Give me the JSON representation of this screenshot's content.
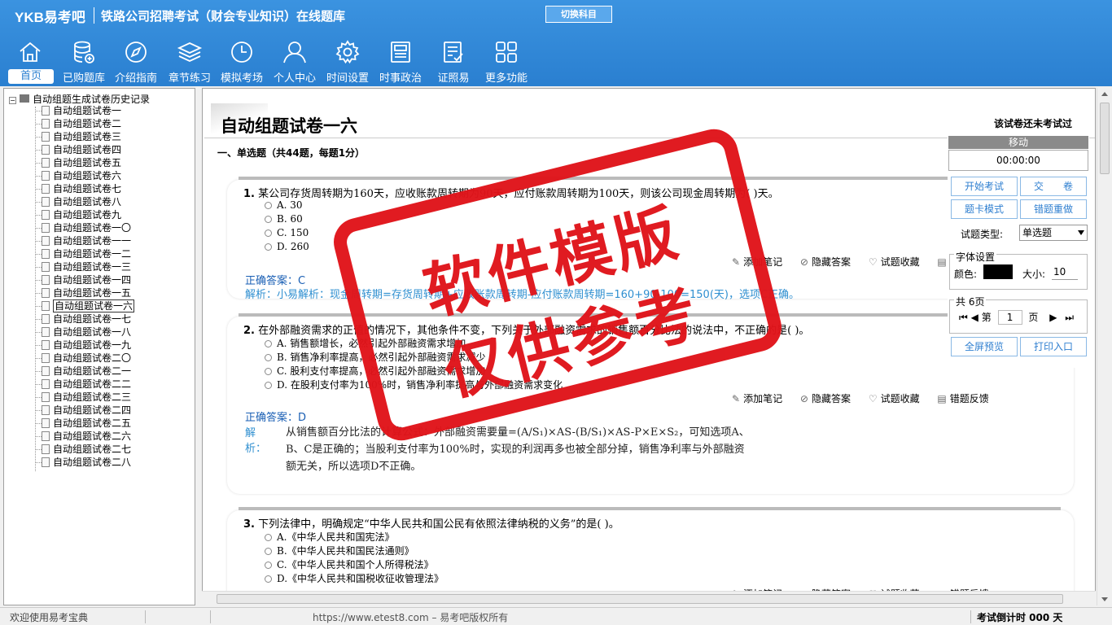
{
  "header": {
    "logo": "YKB易考吧",
    "title": "铁路公司招聘考试（财会专业知识）在线题库",
    "switch_label": "切换科目"
  },
  "nav": [
    {
      "label": "首页",
      "icon": "home-icon"
    },
    {
      "label": "已购题库",
      "icon": "database-icon"
    },
    {
      "label": "介绍指南",
      "icon": "compass-icon"
    },
    {
      "label": "章节练习",
      "icon": "layers-icon"
    },
    {
      "label": "模拟考场",
      "icon": "clock-icon"
    },
    {
      "label": "个人中心",
      "icon": "user-icon"
    },
    {
      "label": "时间设置",
      "icon": "gear-icon"
    },
    {
      "label": "时事政治",
      "icon": "news-icon"
    },
    {
      "label": "证照易",
      "icon": "checklist-icon"
    },
    {
      "label": "更多功能",
      "icon": "grid-icon"
    }
  ],
  "tree": {
    "root": "自动组题生成试卷历史记录",
    "items": [
      "自动组题试卷一",
      "自动组题试卷二",
      "自动组题试卷三",
      "自动组题试卷四",
      "自动组题试卷五",
      "自动组题试卷六",
      "自动组题试卷七",
      "自动组题试卷八",
      "自动组题试卷九",
      "自动组题试卷一〇",
      "自动组题试卷一一",
      "自动组题试卷一二",
      "自动组题试卷一三",
      "自动组题试卷一四",
      "自动组题试卷一五",
      "自动组题试卷一六",
      "自动组题试卷一七",
      "自动组题试卷一八",
      "自动组题试卷一九",
      "自动组题试卷二〇",
      "自动组题试卷二一",
      "自动组题试卷二二",
      "自动组题试卷二三",
      "自动组题试卷二四",
      "自动组题试卷二五",
      "自动组题试卷二六",
      "自动组题试卷二七",
      "自动组题试卷二八"
    ],
    "selected_index": 15
  },
  "paper": {
    "title": "自动组题试卷一六",
    "status": "该试卷还未考试过",
    "section": "一、单选题（共44题，每题1分）"
  },
  "tools": {
    "note": "添加笔记",
    "hide": "隐藏答案",
    "fav": "试题收藏",
    "report": "错题反馈"
  },
  "questions": [
    {
      "no": "1.",
      "stem": "某公司存货周转期为160天，应收账款周转期为90天，应付账款周转期为100天，则该公司现金周转期为( )天。",
      "options": [
        "A. 30",
        "B. 60",
        "C. 150",
        "D. 260"
      ],
      "answer": "正确答案：C",
      "analysis": "解析：小易解析：现金周转期=存货周转期+应收账款周转期-应付账款周转期=160+90-100=150(天)，选项C正确。"
    },
    {
      "no": "2.",
      "stem": "在外部融资需求的正值的情况下，其他条件不变，下列关于外部融资需求的销售额百分比法的说法中，不正确的是( )。",
      "options": [
        "A. 销售额增长，必然引起外部融资需求增加",
        "B. 销售净利率提高，必然引起外部融资需求减少",
        "C. 股利支付率提高，必然引起外部融资需求增加",
        "D. 在股利支付率为100%时，销售净利率提高与外部融资需求变化"
      ],
      "answer": "正确答案：D",
      "analysis_label": "解析：",
      "analysis_lines": [
        "从销售额百分比法的计算公式：外部融资需要量=(A/S₁)×AS-(B/S₁)×AS-P×E×S₂，可知选项A、",
        "B、C是正确的；当股利支付率为100%时，实现的利润再多也被全部分掉，销售净利率与外部融资",
        "额无关，所以选项D不正确。"
      ]
    },
    {
      "no": "3.",
      "stem": "下列法律中，明确规定“中华人民共和国公民有依照法律纳税的义务”的是( )。",
      "options": [
        "A.《中华人民共和国宪法》",
        "B.《中华人民共和国民法通则》",
        "C.《中华人民共和国个人所得税法》",
        "D.《中华人民共和国税收征收管理法》"
      ]
    }
  ],
  "panel": {
    "move": "移动",
    "timer": "00:00:00",
    "start": "开始考试",
    "submit": "交　　卷",
    "card_mode": "题卡模式",
    "redo_wrong": "错题重做",
    "qtype_label": "试题类型:",
    "qtype_value": "单选题",
    "font_settings": "字体设置",
    "color_label": "颜色:",
    "color_value": "#000000",
    "size_label": "大小:",
    "size_value": "10",
    "pages_label": "共 6页",
    "page_prefix": "第",
    "page_value": "1",
    "page_suffix": "页",
    "preview": "全屏预览",
    "print": "打印入口"
  },
  "status": {
    "welcome": "欢迎使用易考宝典",
    "copyright": "https://www.etest8.com – 易考吧版权所有",
    "countdown": "考试倒计时 000 天"
  },
  "stamp": {
    "line1": "软件模版",
    "line2": "仅供参考"
  },
  "colors": {
    "header": "#2a7fd0",
    "accent": "#2f7fd0",
    "stamp": "#e0141a"
  }
}
